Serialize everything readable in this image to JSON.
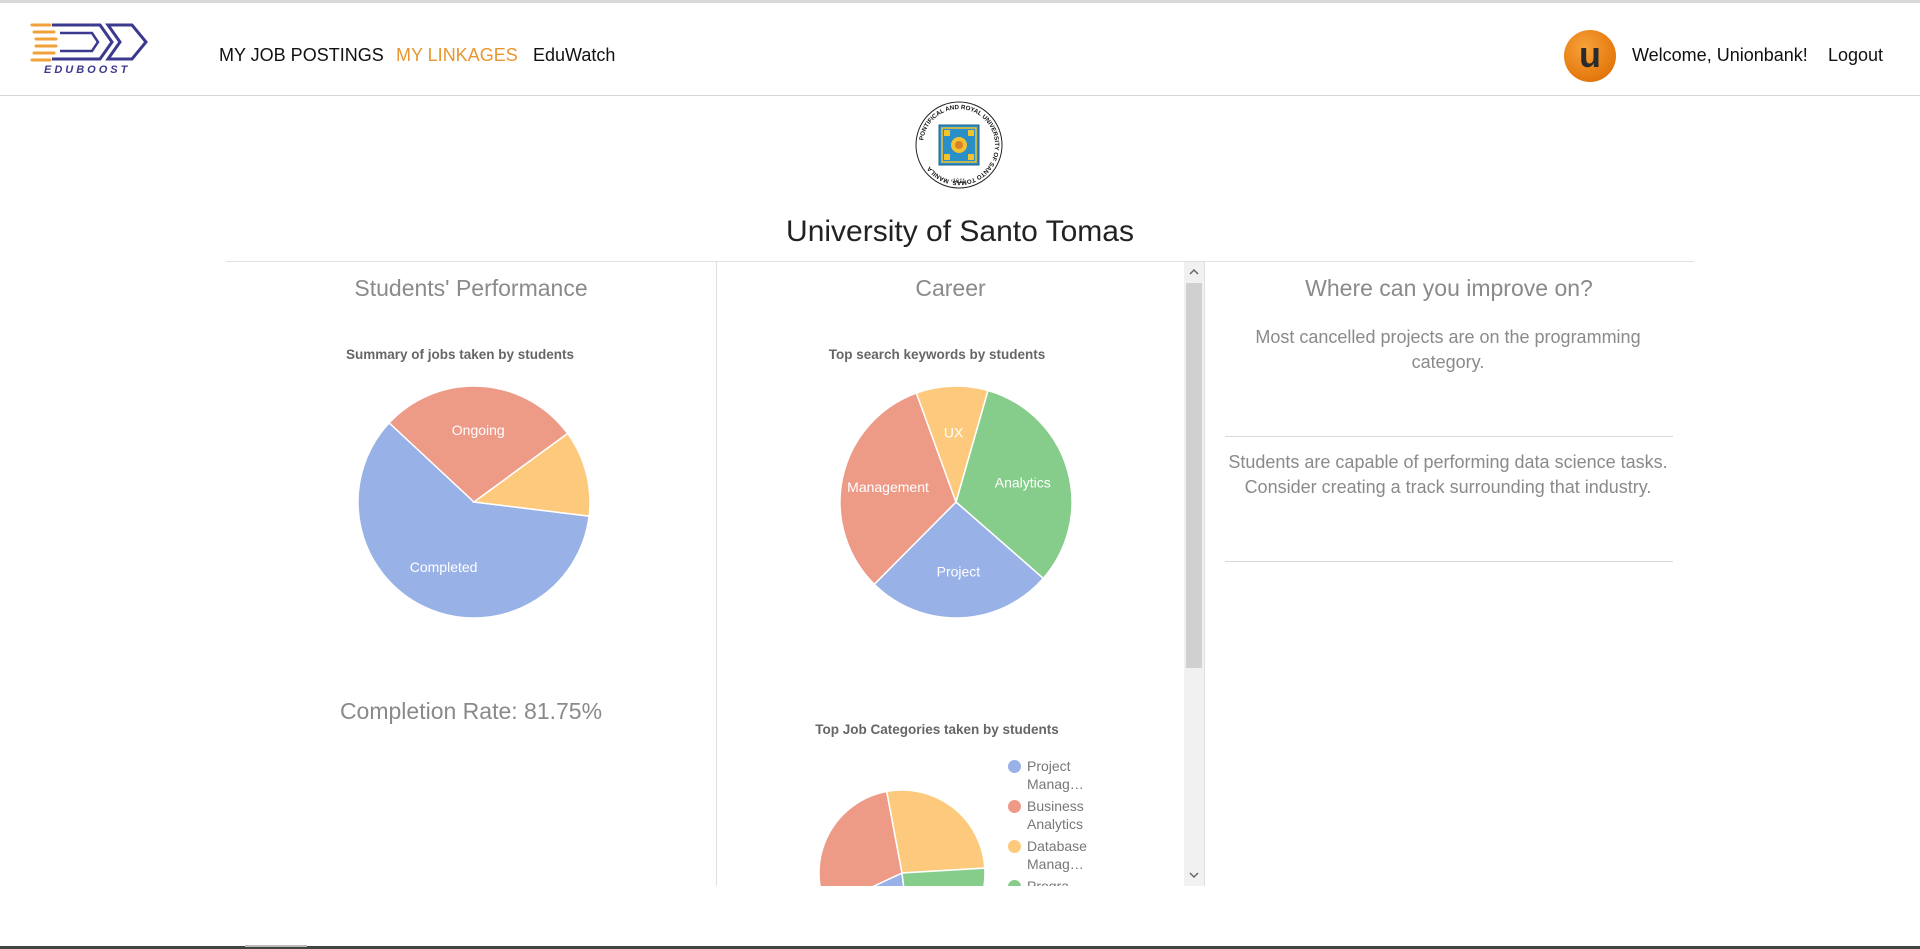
{
  "header": {
    "logo_text": "EDUBOOST",
    "nav": [
      {
        "label": "MY JOB POSTINGS",
        "active": false
      },
      {
        "label": "MY LINKAGES",
        "active": true
      },
      {
        "label": "EduWatch",
        "active": false
      }
    ],
    "avatar_letter": "u",
    "welcome": "Welcome, Unionbank!",
    "logout": "Logout"
  },
  "university": {
    "name": "University of Santo Tomas",
    "seal_text": "PONTIFICAL AND ROYAL UNIVERSITY OF SANTO TOMAS, MANILA",
    "seal_year": "1611"
  },
  "performance": {
    "title": "Students' Performance",
    "completion_rate": "Completion Rate: 81.75%"
  },
  "career": {
    "title": "Career"
  },
  "improve": {
    "title": "Where can you improve on?",
    "tips": [
      "Most cancelled projects are on the programming category.",
      "Students are capable of performing data science tasks. Consider creating a track surrounding that industry."
    ]
  },
  "colors": {
    "blue": "#98b1e6",
    "salmon": "#ed9a87",
    "yellow": "#fdca7d",
    "green": "#86cc8a",
    "accent": "#e8962f"
  },
  "chart_data": [
    {
      "type": "pie",
      "title": "Summary of jobs taken by students",
      "categories": [
        "Completed",
        "Ongoing",
        ""
      ],
      "values": [
        60,
        28,
        12
      ],
      "colors": [
        "#98b1e6",
        "#ed9a87",
        "#fdca7d"
      ]
    },
    {
      "type": "pie",
      "title": "Top search keywords by students",
      "categories": [
        "Analytics",
        "Project",
        "Management",
        "UX"
      ],
      "values": [
        32,
        26,
        32,
        10
      ],
      "colors": [
        "#86cc8a",
        "#98b1e6",
        "#ed9a87",
        "#fdca7d"
      ]
    },
    {
      "type": "pie",
      "title": "Top Job Categories taken by students",
      "categories": [
        "Project Manag…",
        "Business Analytics",
        "Database Manag…",
        "Progra…"
      ],
      "values": [
        20,
        29,
        27,
        24
      ],
      "colors": [
        "#98b1e6",
        "#ed9a87",
        "#fdca7d",
        "#86cc8a"
      ]
    }
  ]
}
